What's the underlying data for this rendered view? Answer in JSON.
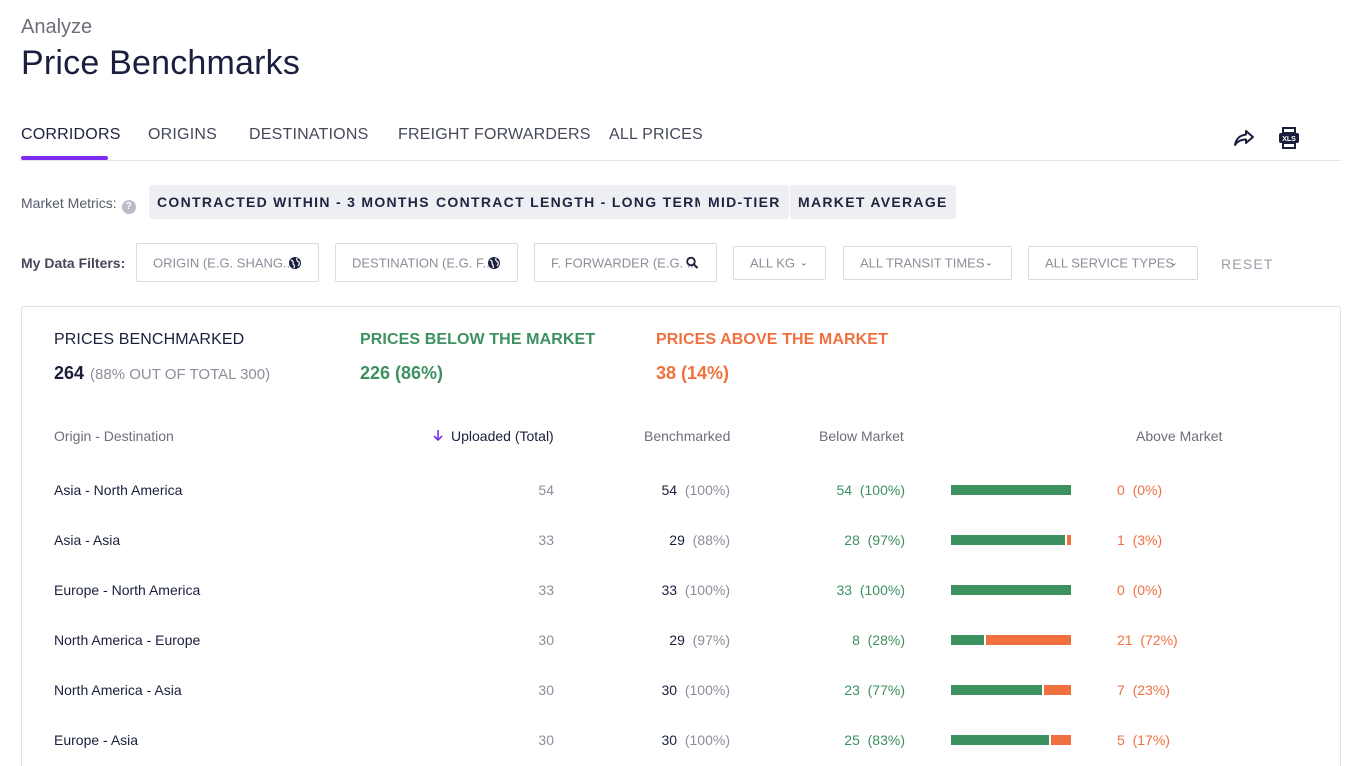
{
  "header": {
    "breadcrumb": "Analyze",
    "title": "Price Benchmarks"
  },
  "tabs": [
    {
      "label": "CORRIDORS",
      "active": true
    },
    {
      "label": "ORIGINS"
    },
    {
      "label": "DESTINATIONS"
    },
    {
      "label": "FREIGHT FORWARDERS"
    },
    {
      "label": "ALL PRICES"
    }
  ],
  "toolbar": {
    "share_icon": "share-icon",
    "export_icon": "xls-export-icon",
    "export_badge": "XLS"
  },
  "metrics": {
    "label": "Market Metrics:",
    "chips": [
      "CONTRACTED WITHIN - 3 MONTHS",
      "CONTRACT LENGTH - LONG TERM",
      "MID-TIER",
      "MARKET AVERAGE"
    ]
  },
  "filters": {
    "label": "My Data Filters:",
    "origin_placeholder": "ORIGIN (E.G. SHANG...",
    "destination_placeholder": "DESTINATION (E.G. F...",
    "forwarder_placeholder": "F. FORWARDER (E.G. ...",
    "kg": "ALL KG",
    "transit": "ALL TRANSIT TIMES",
    "service": "ALL SERVICE TYPES",
    "reset": "RESET"
  },
  "summary": {
    "benchmarked": {
      "title": "PRICES BENCHMARKED",
      "value": "264",
      "sub": "(88%  OUT OF TOTAL 300)"
    },
    "below": {
      "title": "PRICES BELOW THE MARKET",
      "value": "226  (86%)"
    },
    "above": {
      "title": "PRICES ABOVE THE MARKET",
      "value": "38  (14%)"
    }
  },
  "table": {
    "headers": {
      "corridor": "Origin - Destination",
      "uploaded": "Uploaded (Total)",
      "benchmarked": "Benchmarked",
      "below": "Below Market",
      "above": "Above Market"
    },
    "rows": [
      {
        "corridor": "Asia - North America",
        "uploaded": "54",
        "bench": "54",
        "bench_pct": "(100%)",
        "below": "54",
        "below_pct": "(100%)",
        "above": "0",
        "above_pct": "(0%)",
        "below_share": 1.0
      },
      {
        "corridor": "Asia - Asia",
        "uploaded": "33",
        "bench": "29",
        "bench_pct": "(88%)",
        "below": "28",
        "below_pct": "(97%)",
        "above": "1",
        "above_pct": "(3%)",
        "below_share": 0.97
      },
      {
        "corridor": "Europe - North America",
        "uploaded": "33",
        "bench": "33",
        "bench_pct": "(100%)",
        "below": "33",
        "below_pct": "(100%)",
        "above": "0",
        "above_pct": "(0%)",
        "below_share": 1.0
      },
      {
        "corridor": "North America - Europe",
        "uploaded": "30",
        "bench": "29",
        "bench_pct": "(97%)",
        "below": "8",
        "below_pct": "(28%)",
        "above": "21",
        "above_pct": "(72%)",
        "below_share": 0.28
      },
      {
        "corridor": "North America - Asia",
        "uploaded": "30",
        "bench": "30",
        "bench_pct": "(100%)",
        "below": "23",
        "below_pct": "(77%)",
        "above": "7",
        "above_pct": "(23%)",
        "below_share": 0.77
      },
      {
        "corridor": "Europe - Asia",
        "uploaded": "30",
        "bench": "30",
        "bench_pct": "(100%)",
        "below": "25",
        "below_pct": "(83%)",
        "above": "5",
        "above_pct": "(17%)",
        "below_share": 0.83
      }
    ]
  },
  "colors": {
    "accent": "#7b2cf0",
    "below": "#3d9160",
    "above": "#f07040"
  }
}
